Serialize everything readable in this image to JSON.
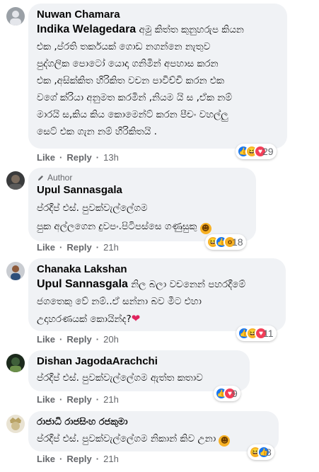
{
  "comments": [
    {
      "name": "Nuwan Chamara",
      "mention": "Indika Welagedara",
      "lines": [
        " අමු කිත්ත කුනුහරුප කියන",
        "එක ,ප්රති තර්කයක් ගොඩ නගන්නෙ නැතුව",
        "පුද්ගලික පොටෝ යොදා ගනිමින් අපහාස කරන",
        "එක ,අසික්කිත හිරිකිත වචන පාවිච්චි කරන එක",
        "වගේ ක්රියා අනුමත කරමින් ,නියම යි ස ,ඒක නම්",
        "මාරයි ස,කිය කිය කොමෙන්ට් කරන පීචං වහල්ලු",
        "සෙට් එක ගැන නම් හිරිකිතයි ."
      ],
      "like": "Like",
      "reply": "Reply",
      "time": "13h",
      "reaction_count": "29",
      "reaction_icons": [
        "like-reaction",
        "haha-reaction",
        "love-reaction"
      ]
    },
    {
      "author_badge": "Author",
      "name": "Upul Sannasgala",
      "lines": [
        "ප්රදීප් එස්. පුවක්වැල්ලේගම",
        "පුක අල්ලගෙන දුවපං.පිටිපස්සෙ ගණුසුකු"
      ],
      "like": "Like",
      "reply": "Reply",
      "time": "21h",
      "reaction_count": "18",
      "reaction_icons": [
        "haha-reaction",
        "like-reaction",
        "wow-reaction"
      ]
    },
    {
      "name": "Chanaka Lakshan",
      "mention": "Upul Sannasgala",
      "lines": [
        " නිල බලා වචනෙන් පහරදීමේ",
        "ජගතෙකු වේ නම්..ඒ සන්නා බව මීට එහා",
        "උදාහරණයක් කොයින්ද?"
      ],
      "like": "Like",
      "reply": "Reply",
      "time": "20h",
      "reaction_count": "11",
      "reaction_icons": [
        "like-reaction",
        "haha-reaction",
        "love-reaction"
      ]
    },
    {
      "name": "Dishan JagodaArachchi",
      "lines": [
        "ප්රදීප් එස්. පුවක්වැල්ලේගම ඇත්ත කතාව"
      ],
      "like": "Like",
      "reply": "Reply",
      "time": "21h",
      "reaction_count": "9",
      "reaction_icons": [
        "like-reaction",
        "love-reaction"
      ]
    },
    {
      "name": "රාජාධි රාජසිංහ රජකුමා",
      "lines": [
        "ප්රදීප් එස්. පුවක්වැල්ලේගම නිකාන් කිව උනා"
      ],
      "like": "Like",
      "reply": "Reply",
      "time": "21h",
      "reaction_count": "8",
      "reaction_icons": [
        "haha-reaction",
        "like-reaction"
      ]
    }
  ],
  "colors": {
    "bubble": "#f0f2f5",
    "secondary_text": "#65676b",
    "like_blue": "#1877f2",
    "love_red": "#f33e58",
    "haha_yellow": "#f7b125"
  }
}
